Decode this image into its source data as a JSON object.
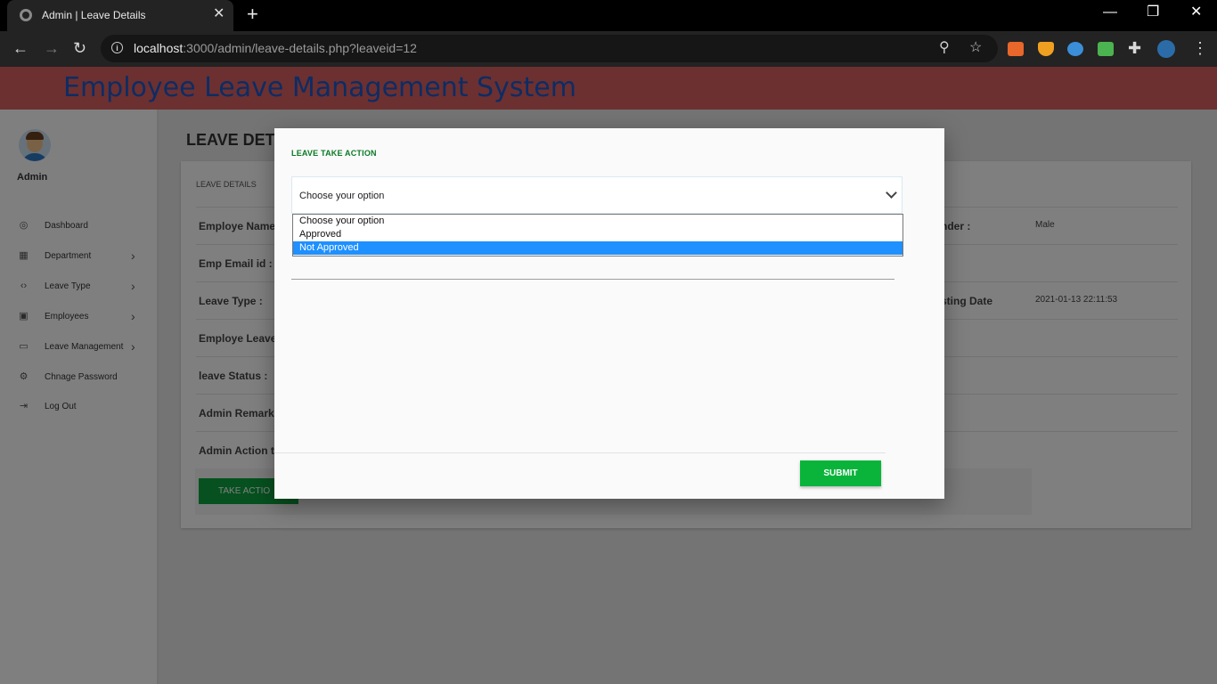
{
  "browser": {
    "tab_title": "Admin | Leave Details",
    "url_host": "localhost",
    "url_rest": ":3000/admin/leave-details.php?leaveid=12"
  },
  "header": {
    "brand": "Employee Leave Management System"
  },
  "sidebar": {
    "user_name": "Admin",
    "items": [
      {
        "label": "Dashboard",
        "icon": "dashboard-icon"
      },
      {
        "label": "Department",
        "icon": "grid-icon"
      },
      {
        "label": "Leave Type",
        "icon": "code-icon"
      },
      {
        "label": "Employees",
        "icon": "person-icon"
      },
      {
        "label": "Leave Management",
        "icon": "monitor-icon"
      },
      {
        "label": "Chnage Password",
        "icon": "settings-icon"
      },
      {
        "label": "Log Out",
        "icon": "logout-icon"
      }
    ]
  },
  "main": {
    "page_title": "LEAVE DETA",
    "card_title": "LEAVE DETAILS",
    "fields": {
      "employe_name": "Employe Name",
      "email": "Emp Email id :",
      "leave_type": "Leave Type :",
      "employe_leave": "Employe Leave",
      "leave_status": "leave Status :",
      "admin_remark": "Admin Remark",
      "admin_action": "Admin Action t",
      "gender_label": "nder :",
      "gender_value": "Male",
      "posting_label": "sting Date",
      "posting_value": "2021-01-13 22:11:53"
    },
    "take_action_label": "TAKE ACTIO"
  },
  "modal": {
    "title": "LEAVE TAKE ACTION",
    "select_value": "Choose your option",
    "options": [
      "Choose your option",
      "Approved",
      "Not Approved"
    ],
    "selected_option": "Not Approved",
    "submit_label": "SUBMIT"
  }
}
